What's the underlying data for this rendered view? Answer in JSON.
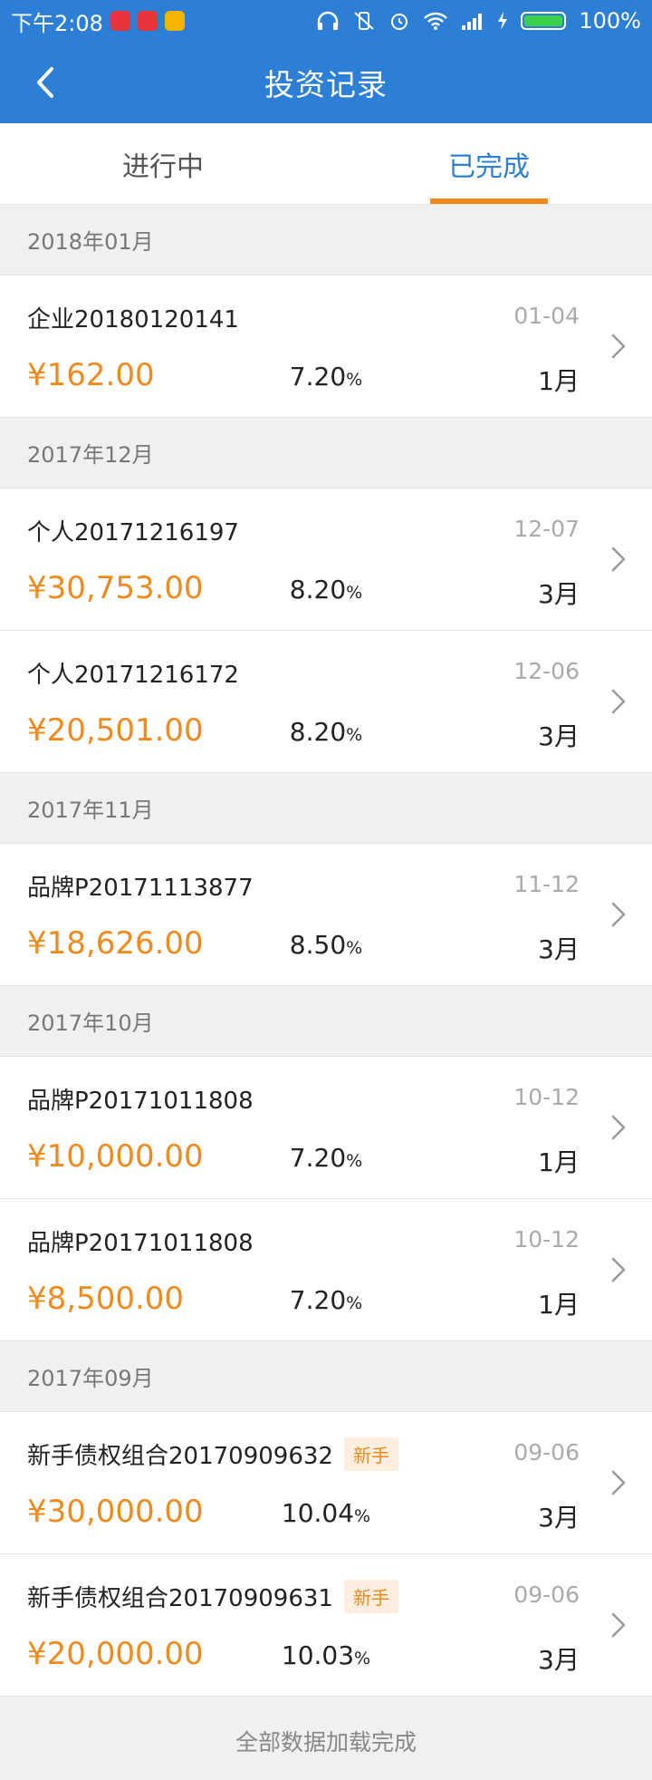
{
  "status_bar": {
    "time": "下午2:08",
    "battery": "100%",
    "battery_level": 1.0,
    "app_badge_colors": [
      "#e8333b",
      "#e8333b",
      "#f4b400"
    ]
  },
  "nav": {
    "title": "投资记录"
  },
  "tabs": [
    {
      "label": "进行中",
      "active": false
    },
    {
      "label": "已完成",
      "active": true
    }
  ],
  "groups": [
    {
      "month": "2018年01月",
      "records": [
        {
          "name": "企业20180120141",
          "tag": "",
          "date": "01-04",
          "amount": "¥162.00",
          "rate": "7.20",
          "term": "1月"
        }
      ]
    },
    {
      "month": "2017年12月",
      "records": [
        {
          "name": "个人20171216197",
          "tag": "",
          "date": "12-07",
          "amount": "¥30,753.00",
          "rate": "8.20",
          "term": "3月"
        },
        {
          "name": "个人20171216172",
          "tag": "",
          "date": "12-06",
          "amount": "¥20,501.00",
          "rate": "8.20",
          "term": "3月"
        }
      ]
    },
    {
      "month": "2017年11月",
      "records": [
        {
          "name": "品牌P20171113877",
          "tag": "",
          "date": "11-12",
          "amount": "¥18,626.00",
          "rate": "8.50",
          "term": "3月"
        }
      ]
    },
    {
      "month": "2017年10月",
      "records": [
        {
          "name": "品牌P20171011808",
          "tag": "",
          "date": "10-12",
          "amount": "¥10,000.00",
          "rate": "7.20",
          "term": "1月"
        },
        {
          "name": "品牌P20171011808",
          "tag": "",
          "date": "10-12",
          "amount": "¥8,500.00",
          "rate": "7.20",
          "term": "1月"
        }
      ]
    },
    {
      "month": "2017年09月",
      "records": [
        {
          "name": "新手债权组合20170909632",
          "tag": "新手",
          "date": "09-06",
          "amount": "¥30,000.00",
          "rate": "10.04",
          "term": "3月"
        },
        {
          "name": "新手债权组合20170909631",
          "tag": "新手",
          "date": "09-06",
          "amount": "¥20,000.00",
          "rate": "10.03",
          "term": "3月"
        }
      ]
    }
  ],
  "percent_symbol": "%",
  "footer": "全部数据加载完成",
  "colors": {
    "primary": "#2d7fd6",
    "accent": "#f08a1d"
  }
}
